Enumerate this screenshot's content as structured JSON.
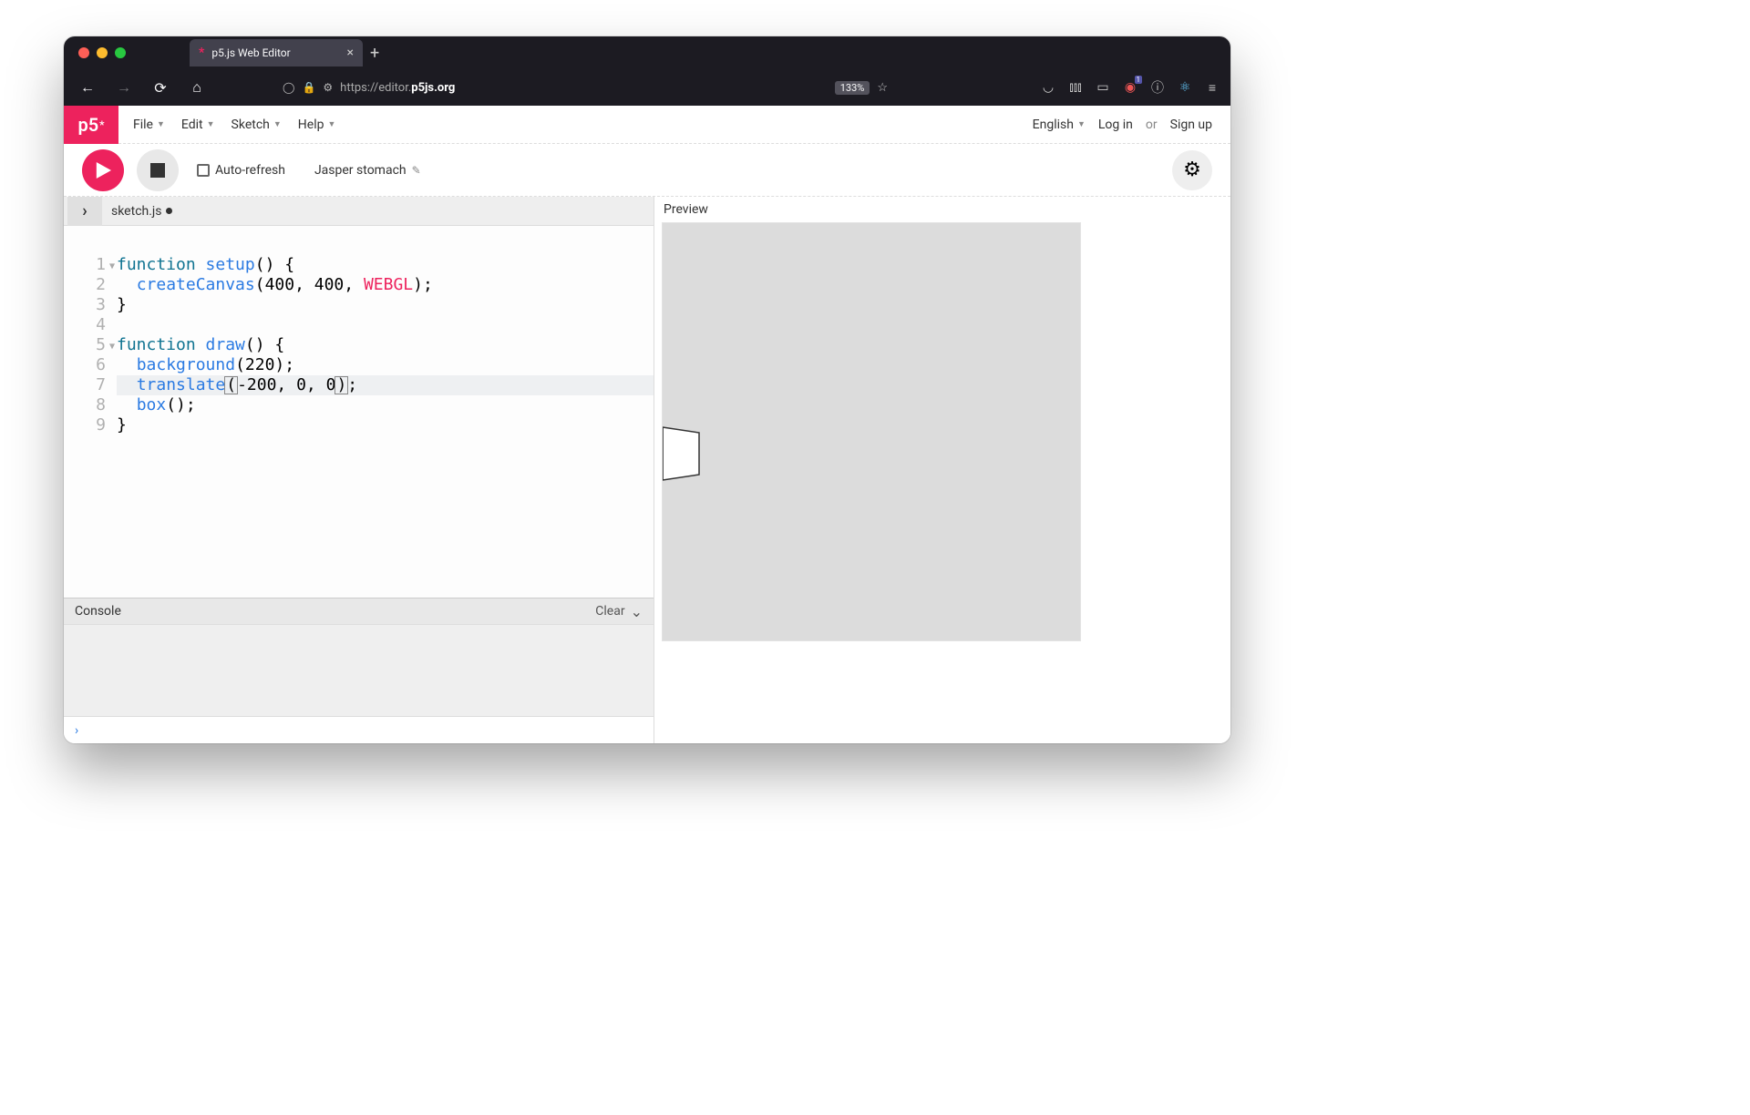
{
  "browser": {
    "tab_title": "p5.js Web Editor",
    "url_prefix": "https://editor.",
    "url_bold": "p5js.org",
    "zoom": "133%"
  },
  "header": {
    "logo": "p5",
    "menus": {
      "file": "File",
      "edit": "Edit",
      "sketch": "Sketch",
      "help": "Help"
    },
    "language": "English",
    "login": "Log in",
    "or": "or",
    "signup": "Sign up"
  },
  "controls": {
    "autorefresh": "Auto-refresh",
    "sketch_name": "Jasper stomach"
  },
  "file": {
    "name": "sketch.js"
  },
  "code_lines": [
    "function setup() {",
    "  createCanvas(400, 400, WEBGL);",
    "}",
    "",
    "function draw() {",
    "  background(220);",
    "  translate(-200, 0, 0);",
    "  box();",
    "}"
  ],
  "code_highlight_line": 7,
  "console": {
    "label": "Console",
    "clear": "Clear"
  },
  "preview": {
    "label": "Preview"
  }
}
